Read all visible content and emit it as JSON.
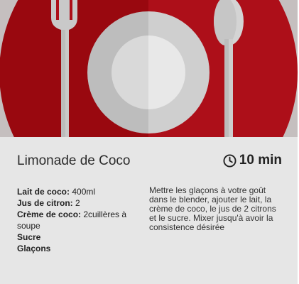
{
  "recipe": {
    "title": "Limonade de Coco",
    "time": "10 min",
    "icons": {
      "clock": "clock-icon",
      "hero": "plate-fork-spoon-icon"
    },
    "colors": {
      "accent_red": "#b10e1a",
      "card_bg": "#e6e6e6"
    },
    "ingredients": [
      {
        "name": "Lait de coco:",
        "qty": " 400ml"
      },
      {
        "name": "Jus de citron:",
        "qty": " 2"
      },
      {
        "name": "Crème de coco:",
        "qty": " 2cuillères à soupe"
      },
      {
        "name": "Sucre",
        "qty": ""
      },
      {
        "name": "Glaçons",
        "qty": ""
      }
    ],
    "instructions": "Mettre les glaçons à votre goût dans le blender, ajouter le lait, la crème de coco, le jus de 2 citrons et le sucre. Mixer jusqu'à avoir la consistence désirée"
  }
}
